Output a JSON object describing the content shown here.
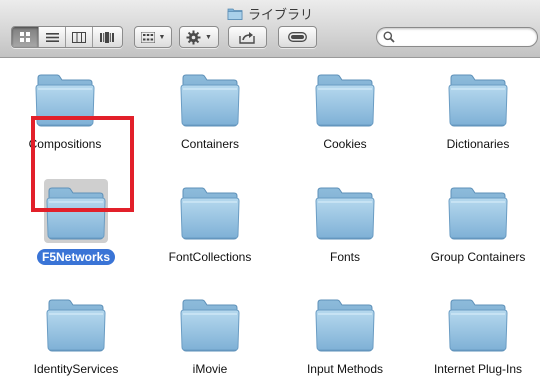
{
  "window": {
    "title": "ライブラリ"
  },
  "toolbar": {
    "view_modes": [
      "icon-view",
      "list-view",
      "column-view",
      "coverflow-view"
    ],
    "active_view": "icon-view",
    "arrange_menu": "arrange",
    "action_menu": "gear",
    "share_button": "share",
    "tags_button": "tags"
  },
  "search": {
    "value": "",
    "placeholder": ""
  },
  "colors": {
    "folder": "#8fbfdf",
    "selection": "#3a74d6",
    "highlight_box": "#e2202a"
  },
  "items": [
    {
      "label": "Compositions"
    },
    {
      "label": "Containers"
    },
    {
      "label": "Cookies"
    },
    {
      "label": "Dictionaries"
    },
    {
      "label": "F5Networks",
      "selected": true
    },
    {
      "label": "FontCollections"
    },
    {
      "label": "Fonts"
    },
    {
      "label": "Group Containers"
    },
    {
      "label": "IdentityServices"
    },
    {
      "label": "iMovie"
    },
    {
      "label": "Input Methods"
    },
    {
      "label": "Internet Plug-Ins"
    }
  ]
}
